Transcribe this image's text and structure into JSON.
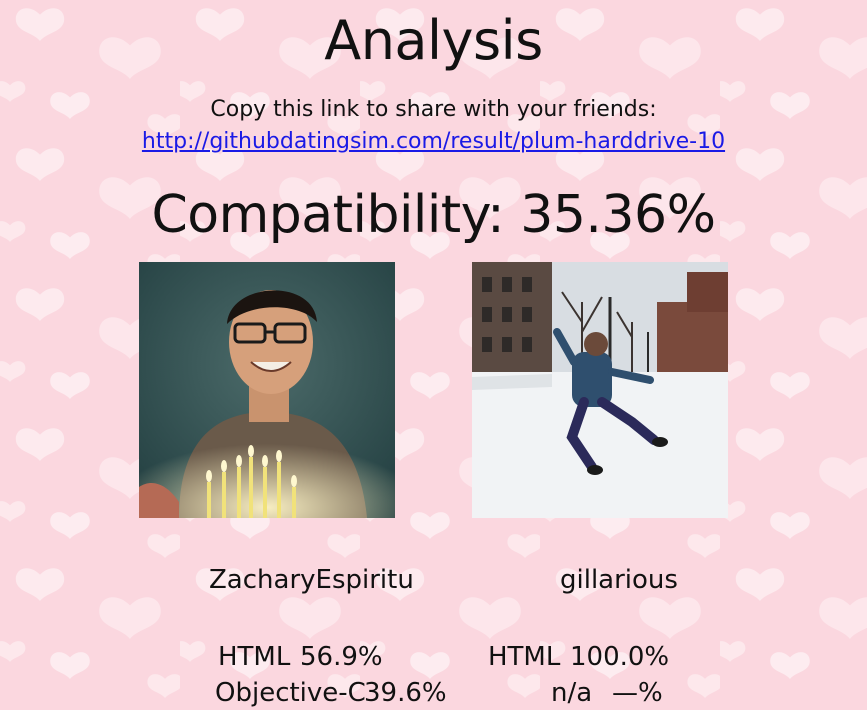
{
  "page": {
    "title": "Analysis",
    "share_text": "Copy this link to share with your friends:",
    "share_link": "http://githubdatingsim.com/result/plum-harddrive-10",
    "compatibility_label": "Compatibility: 35.36%",
    "compatibility_value": 35.36
  },
  "users": [
    {
      "username": "ZacharyEspiritu",
      "photo": "avatar-photo-birthday-candles",
      "languages": [
        {
          "name": "HTML",
          "percent": "56.9%"
        },
        {
          "name": "Objective-C",
          "percent": "39.6%"
        }
      ]
    },
    {
      "username": "gillarious",
      "photo": "avatar-photo-snow-jump",
      "languages": [
        {
          "name": "HTML",
          "percent": "100.0%"
        },
        {
          "name": "n/a",
          "percent": "—%"
        }
      ]
    }
  ],
  "colors": {
    "background": "#fbd7df",
    "heart": "#fdeaee",
    "link": "#1a1ae6",
    "text": "#111111"
  }
}
